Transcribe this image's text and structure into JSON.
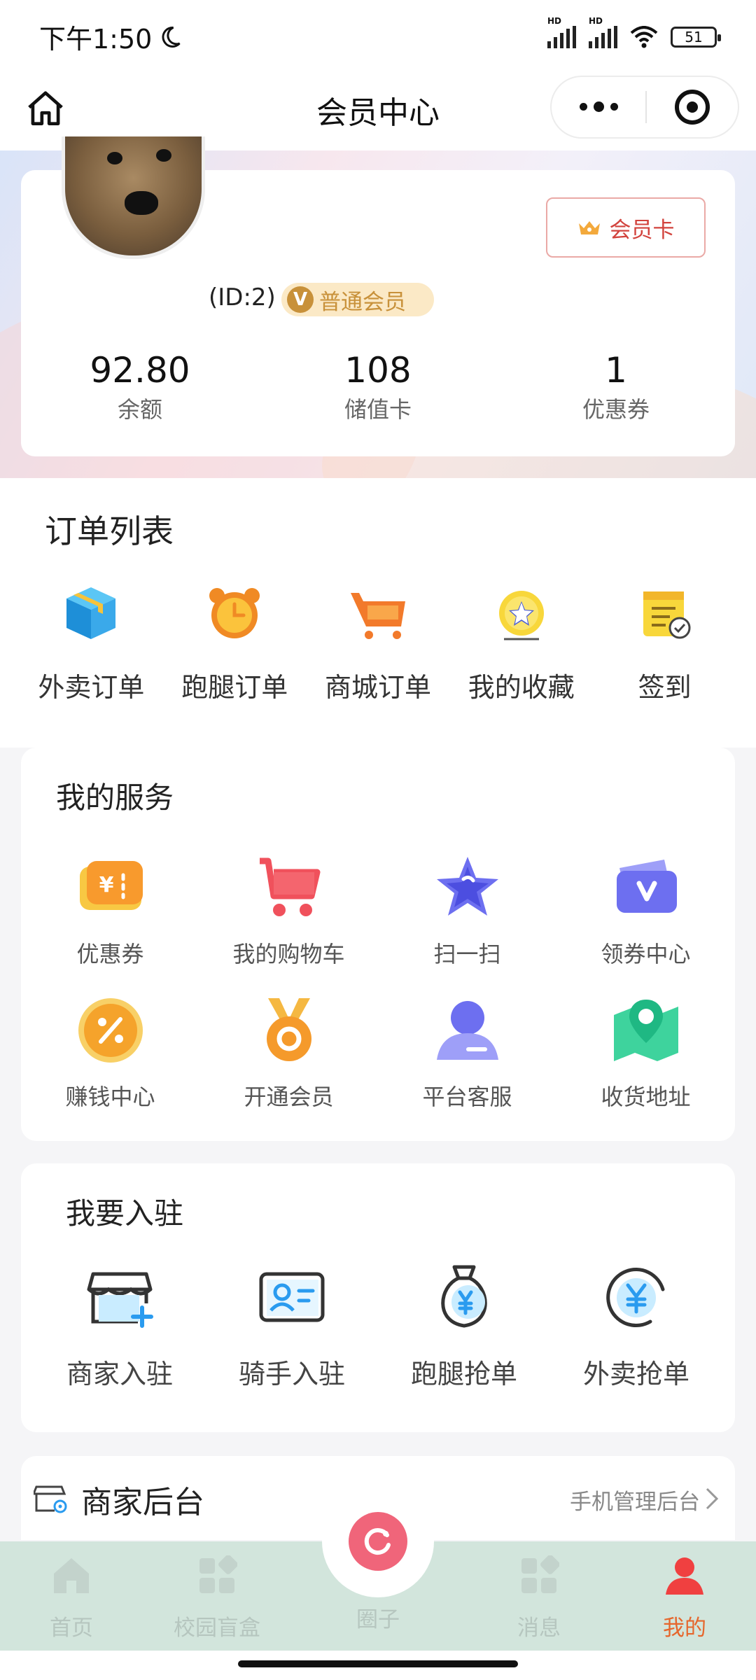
{
  "status_bar": {
    "time": "下午1:50",
    "signal1_tag": "HD",
    "signal2_tag": "HD",
    "battery": "51"
  },
  "nav": {
    "title": "会员中心"
  },
  "profile": {
    "member_card_label": "会员卡",
    "uid": "(ID:2)",
    "level_icon": "V",
    "level": "普通会员",
    "stats": [
      {
        "value": "92.80",
        "label": "余额"
      },
      {
        "value": "108",
        "label": "储值卡"
      },
      {
        "value": "1",
        "label": "优惠券"
      }
    ]
  },
  "orders": {
    "title": "订单列表",
    "items": [
      {
        "label": "外卖订单",
        "icon": "package-box-icon"
      },
      {
        "label": "跑腿订单",
        "icon": "alarm-clock-icon"
      },
      {
        "label": "商城订单",
        "icon": "shopping-cart-icon"
      },
      {
        "label": "我的收藏",
        "icon": "star-medal-icon"
      },
      {
        "label": "签到",
        "icon": "calendar-check-icon"
      }
    ]
  },
  "services": {
    "title": "我的服务",
    "items": [
      {
        "label": "优惠券",
        "icon": "coupon-icon"
      },
      {
        "label": "我的购物车",
        "icon": "cart-icon"
      },
      {
        "label": "扫一扫",
        "icon": "star-icon"
      },
      {
        "label": "领券中心",
        "icon": "voucher-icon"
      },
      {
        "label": "赚钱中心",
        "icon": "percent-icon"
      },
      {
        "label": "开通会员",
        "icon": "medal-icon"
      },
      {
        "label": "平台客服",
        "icon": "customer-service-icon"
      },
      {
        "label": "收货地址",
        "icon": "map-pin-icon"
      }
    ]
  },
  "settle": {
    "title": "我要入驻",
    "items": [
      {
        "label": "商家入驻",
        "icon": "store-add-icon"
      },
      {
        "label": "骑手入驻",
        "icon": "id-card-icon"
      },
      {
        "label": "跑腿抢单",
        "icon": "money-bag-icon"
      },
      {
        "label": "外卖抢单",
        "icon": "yuan-circle-icon"
      }
    ]
  },
  "backend": {
    "title": "商家后台",
    "link": "手机管理后台"
  },
  "tabbar": {
    "items": [
      {
        "label": "首页"
      },
      {
        "label": "校园盲盒"
      },
      {
        "label": "圈子"
      },
      {
        "label": "消息"
      },
      {
        "label": "我的"
      }
    ]
  },
  "colors": {
    "accent": "#e6662c",
    "member_red": "#d2433d",
    "gold": "#c8913a",
    "tabbar_bg": "#d2e5dc"
  }
}
